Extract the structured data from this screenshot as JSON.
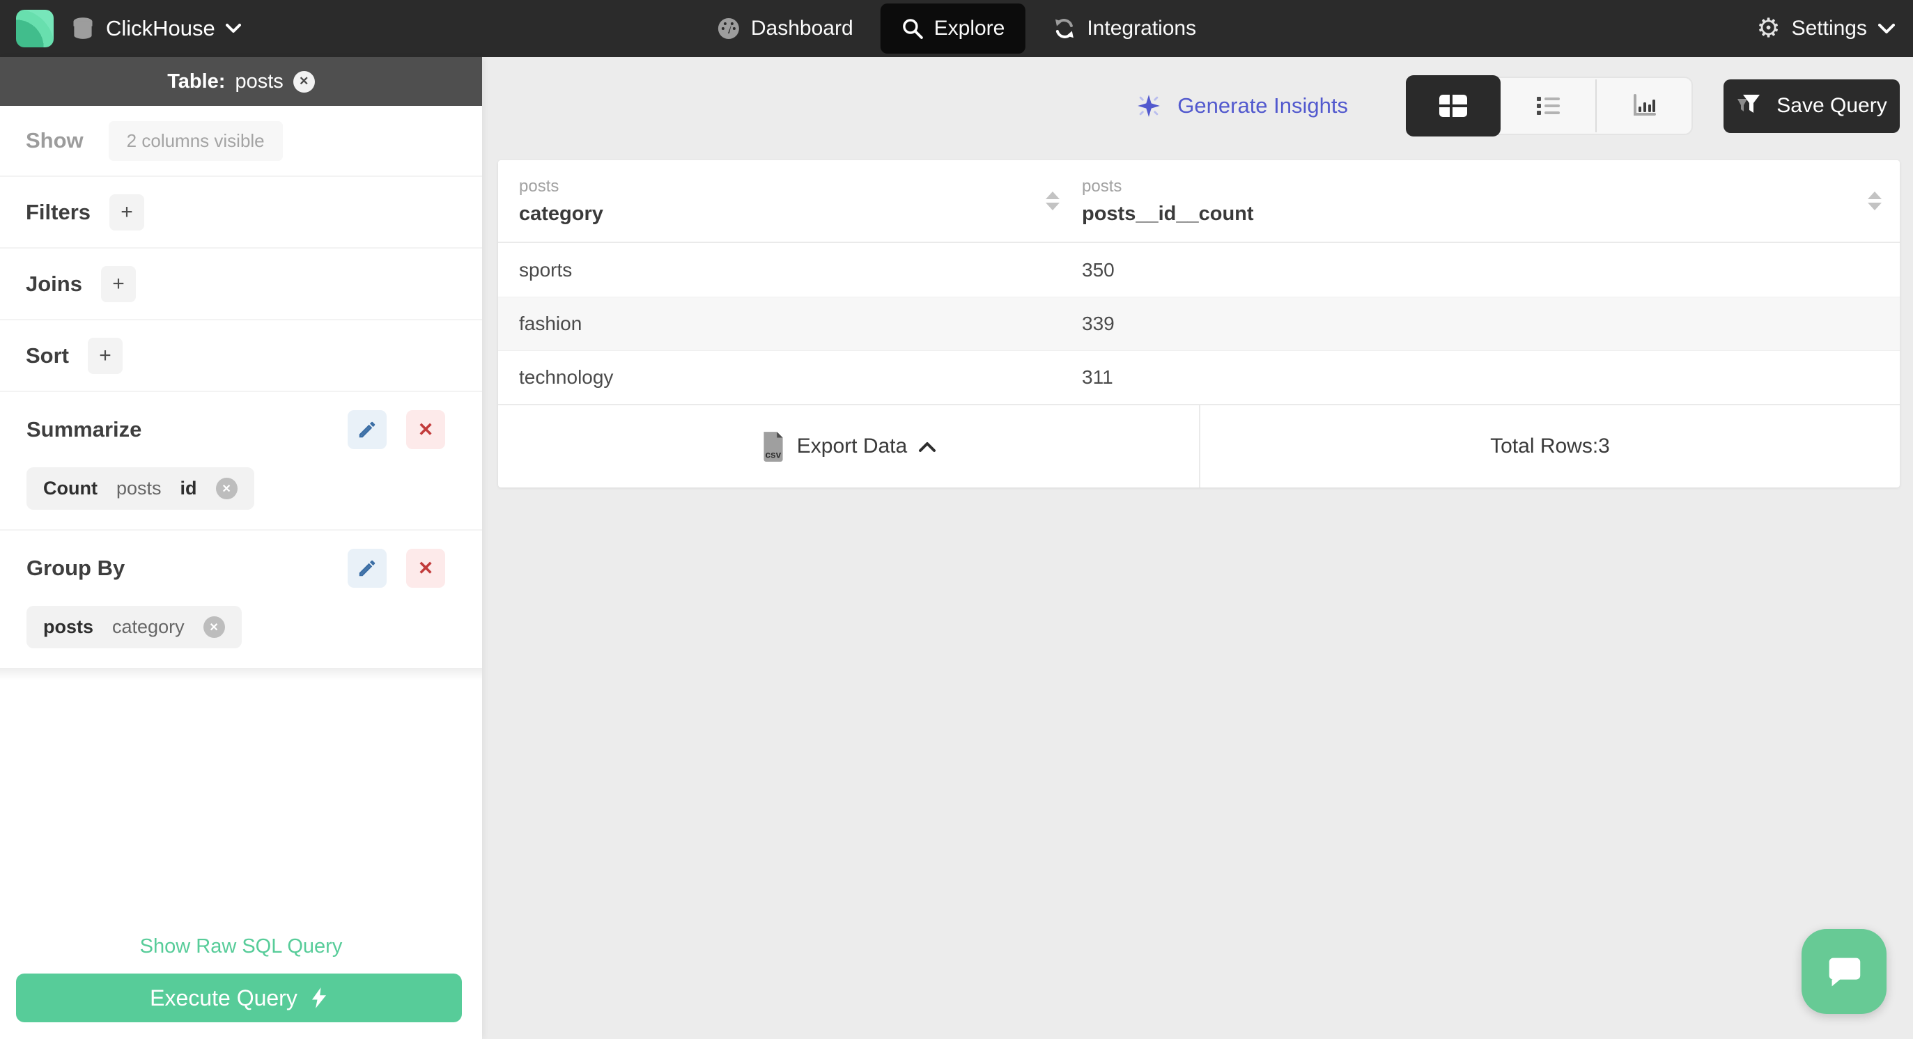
{
  "nav": {
    "brand": {
      "label": "ClickHouse"
    },
    "items": [
      {
        "label": "Dashboard"
      },
      {
        "label": "Explore"
      },
      {
        "label": "Integrations"
      }
    ],
    "settings_label": "Settings"
  },
  "sidebar": {
    "table_banner": {
      "prefix": "Table:",
      "table": "posts"
    },
    "show": {
      "label": "Show",
      "value": "2 columns visible"
    },
    "sections": [
      {
        "label": "Filters",
        "add_label": "+"
      },
      {
        "label": "Joins",
        "add_label": "+"
      },
      {
        "label": "Sort",
        "add_label": "+"
      }
    ],
    "summarize": {
      "label": "Summarize",
      "chip": {
        "agg": "Count",
        "table": "posts",
        "column": "id"
      }
    },
    "group_by": {
      "label": "Group By",
      "chip": {
        "table": "posts",
        "column": "category"
      }
    },
    "raw_sql_link": "Show Raw SQL Query",
    "execute_label": "Execute Query"
  },
  "toolbar": {
    "generate_insights_label": "Generate Insights",
    "save_query_label": "Save Query"
  },
  "results": {
    "columns": [
      {
        "group": "posts",
        "name": "category"
      },
      {
        "group": "posts",
        "name": "posts__id__count"
      }
    ],
    "rows": [
      {
        "category": "sports",
        "count": "350"
      },
      {
        "category": "fashion",
        "count": "339"
      },
      {
        "category": "technology",
        "count": "311"
      }
    ],
    "export_label": "Export Data",
    "total_rows_label": "Total Rows:3"
  },
  "colors": {
    "accent_green": "#57cc99",
    "chat_green": "#67ca95",
    "insights_indigo": "#5259ce",
    "edit_blue": "#3b6ea5",
    "delete_red": "#c23b3b",
    "nav_dark": "#2b2b2b",
    "active_pill_dark": "#0c0c0c",
    "table_banner_gray": "#4f4f4f"
  }
}
